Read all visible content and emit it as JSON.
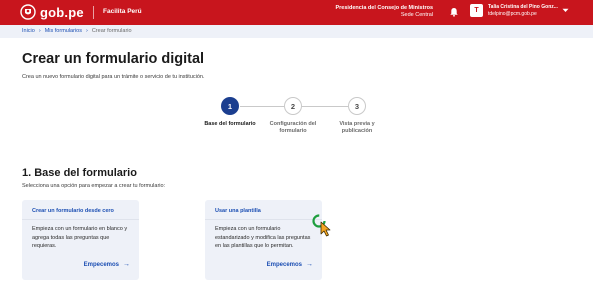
{
  "header": {
    "logo_text": "gob.pe",
    "product": "Facilita Perú",
    "entity_name": "Presidencia del Consejo de Ministros",
    "entity_location": "Sede Central",
    "user_initial": "T",
    "user_name": "Talia Cristina del Pino Gonz...",
    "user_email": "tdelpino@pcm.gob.pe",
    "brand_color": "#c8151d"
  },
  "breadcrumb": {
    "items": [
      "Inicio",
      "Mis formularios",
      "Crear formulario"
    ]
  },
  "page": {
    "title": "Crear un formulario digital",
    "subtitle": "Crea un nuevo formulario digital para un trámite o servicio de tu institución."
  },
  "stepper": {
    "steps": [
      {
        "number": "1",
        "label_line1": "Base del formulario",
        "label_line2": "",
        "state": "active"
      },
      {
        "number": "2",
        "label_line1": "Configuración del",
        "label_line2": "formulario",
        "state": "idle"
      },
      {
        "number": "3",
        "label_line1": "Vista previa y",
        "label_line2": "publicación",
        "state": "idle"
      }
    ]
  },
  "section": {
    "title": "1. Base del formulario",
    "subtitle": "Selecciona una opción para empezar a crear tu formulario:"
  },
  "cards": [
    {
      "title": "Crear un formulario desde cero",
      "description": "Empieza con un formulario en blanco y agrega todas las preguntas que requieras.",
      "cta": "Empecemos"
    },
    {
      "title": "Usar una plantilla",
      "description": "Empieza con un formulario estandarizado y modifica las preguntas en las plantillas que lo permitan.",
      "cta": "Empecemos"
    }
  ]
}
